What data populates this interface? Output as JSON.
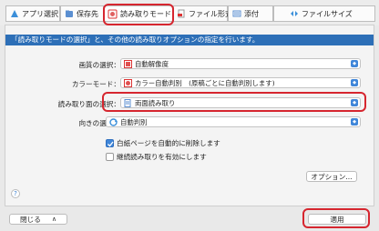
{
  "tabs": [
    {
      "label": "アプリ選択"
    },
    {
      "label": "保存先"
    },
    {
      "label": "読み取りモード"
    },
    {
      "label": "ファイル形式"
    },
    {
      "label": "添付"
    },
    {
      "label": "ファイルサイズ"
    }
  ],
  "info_text": "「読み取りモードの選択」と、その他の読み取りオプションの指定を行います。",
  "settings": {
    "quality": {
      "label": "画質の選択：",
      "value": "自動解像度"
    },
    "color": {
      "label": "カラーモード：",
      "value": "カラー自動判別　(原稿ごとに自動判別します)"
    },
    "side": {
      "label": "読み取り面の選択：",
      "value": "両面読み取り"
    },
    "orientation": {
      "label": "向きの選択：",
      "value": "自動判別"
    }
  },
  "checkboxes": [
    {
      "label": "白紙ページを自動的に削除します",
      "checked": true
    },
    {
      "label": "継続読み取りを有効にします",
      "checked": false
    }
  ],
  "options_button": "オプション...",
  "help_symbol": "?",
  "footer": {
    "close_label": "閉じる",
    "close_arrow": "∧",
    "apply_label": "適用"
  }
}
